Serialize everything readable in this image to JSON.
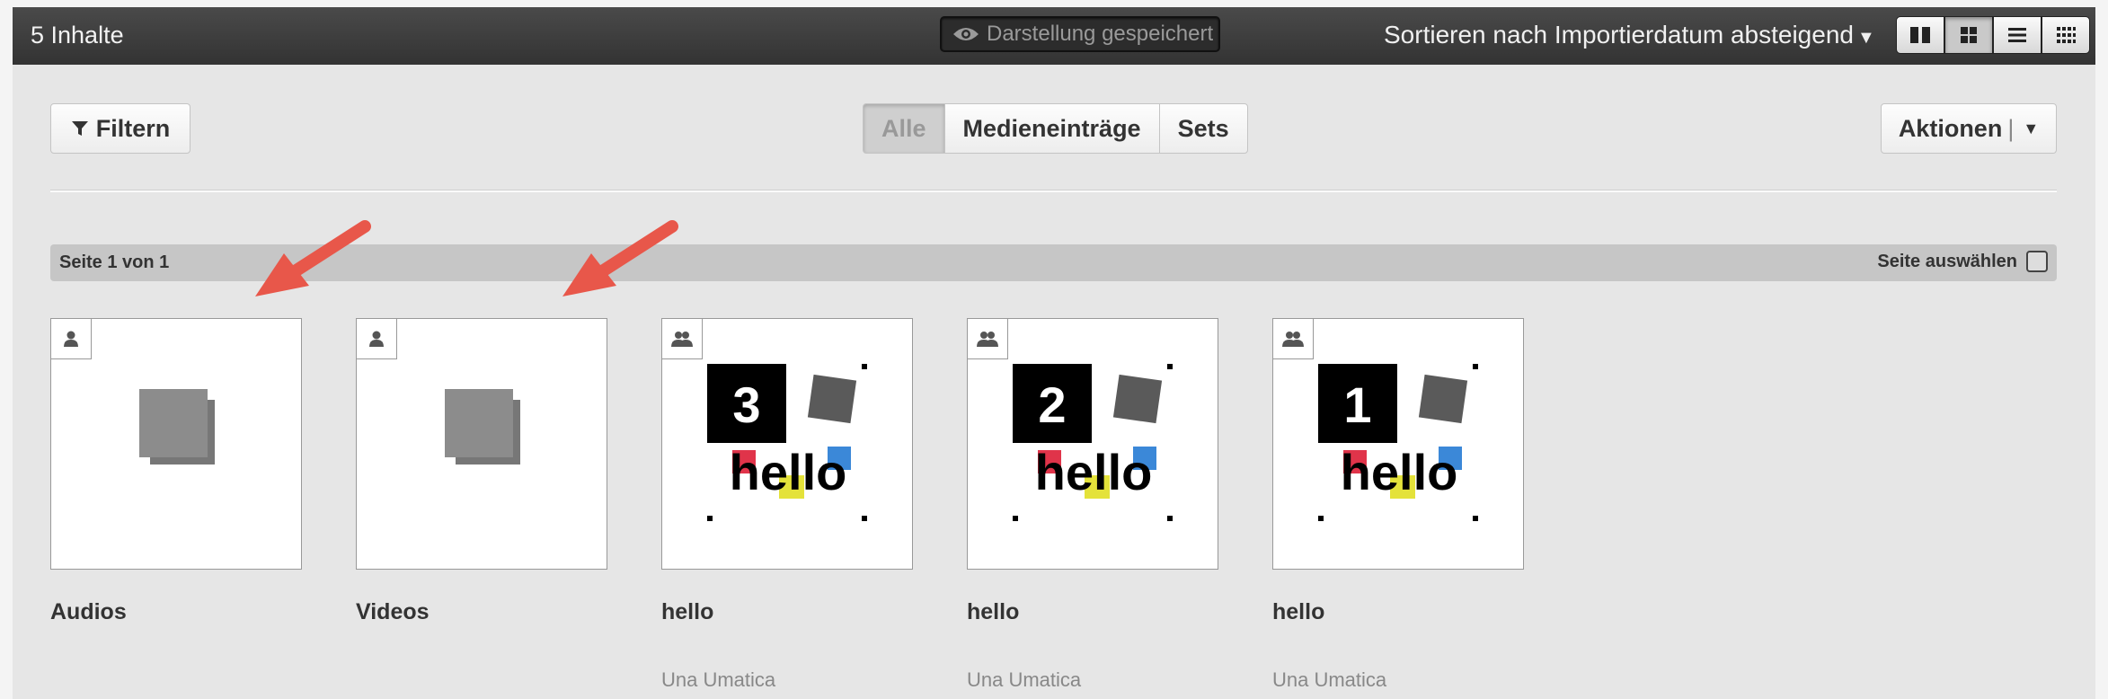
{
  "topbar": {
    "count": "5 Inhalte",
    "saved_label": "Darstellung gespeichert",
    "sort_label": "Sortieren nach Importierdatum absteigend",
    "view_modes": [
      "tiles-large-icon",
      "grid-icon",
      "list-icon",
      "grid-small-icon"
    ],
    "active_view": 1
  },
  "toolbar": {
    "filter_label": "Filtern",
    "segments": [
      "Alle",
      "Medieneinträge",
      "Sets"
    ],
    "active_segment": "Alle",
    "actions_label": "Aktionen",
    "actions_sep": "|"
  },
  "pager": {
    "page_info": "Seite 1 von 1",
    "select_page": "Seite auswählen"
  },
  "items": [
    {
      "title": "Audios",
      "author": "",
      "kind": "set",
      "badge": "person-icon"
    },
    {
      "title": "Videos",
      "author": "",
      "kind": "set",
      "badge": "person-icon"
    },
    {
      "title": "hello",
      "author": "Una Umatica",
      "kind": "entry",
      "badge": "group-icon",
      "number": "3",
      "text": "hello"
    },
    {
      "title": "hello",
      "author": "Una Umatica",
      "kind": "entry",
      "badge": "group-icon",
      "number": "2",
      "text": "hello"
    },
    {
      "title": "hello",
      "author": "Una Umatica",
      "kind": "entry",
      "badge": "group-icon",
      "number": "1",
      "text": "hello"
    }
  ],
  "colors": {
    "arrow": "#e8574a",
    "red": "#e0344a",
    "blue": "#3b88d8",
    "yellow": "#e4e23a"
  }
}
